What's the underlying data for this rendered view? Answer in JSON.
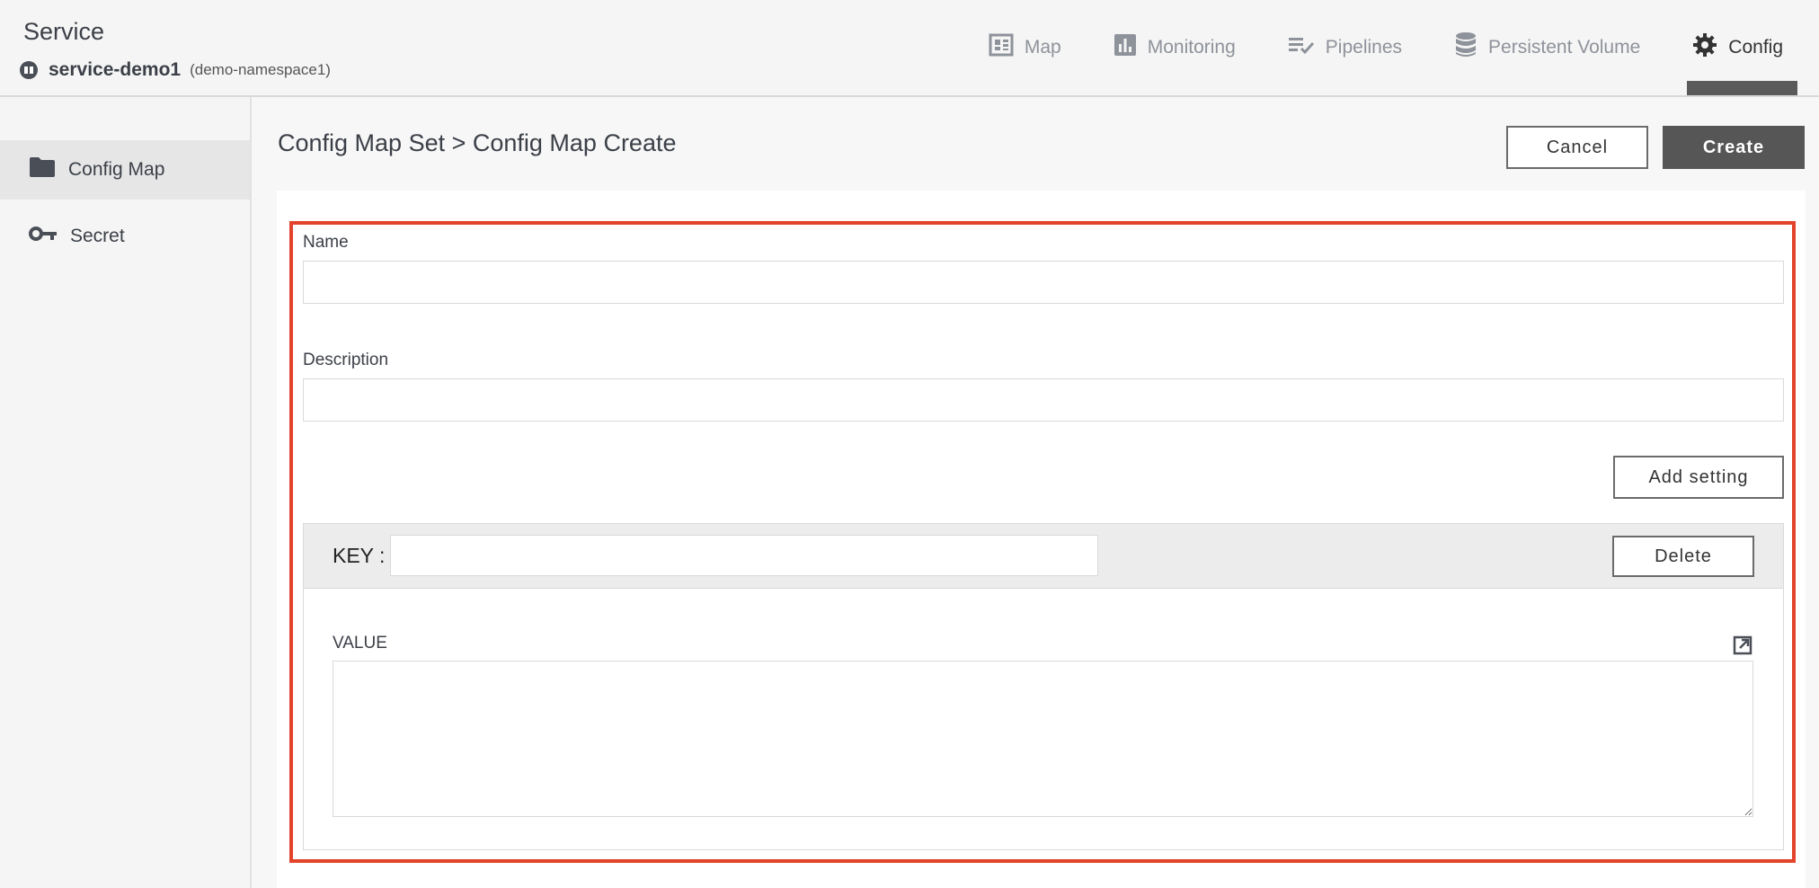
{
  "header": {
    "app_title": "Service",
    "service_name": "service-demo1",
    "namespace": "(demo-namespace1)",
    "tabs": [
      {
        "label": "Map",
        "icon": "dashboard-icon",
        "active": false
      },
      {
        "label": "Monitoring",
        "icon": "bar-chart-icon",
        "active": false
      },
      {
        "label": "Pipelines",
        "icon": "list-check-icon",
        "active": false
      },
      {
        "label": "Persistent Volume",
        "icon": "database-icon",
        "active": false
      },
      {
        "label": "Config",
        "icon": "gear-icon",
        "active": true
      }
    ]
  },
  "sidebar": {
    "items": [
      {
        "label": "Config Map",
        "icon": "folder-icon",
        "active": true
      },
      {
        "label": "Secret",
        "icon": "key-icon",
        "active": false
      }
    ]
  },
  "main": {
    "breadcrumb": "Config Map Set > Config Map Create",
    "cancel_label": "Cancel",
    "create_label": "Create",
    "form": {
      "name_label": "Name",
      "name_value": "",
      "description_label": "Description",
      "description_value": "",
      "add_setting_label": "Add setting",
      "entry": {
        "key_label": "KEY :",
        "key_value": "",
        "delete_label": "Delete",
        "value_label": "VALUE",
        "value_value": ""
      }
    }
  },
  "colors": {
    "highlight_border": "#e2432a",
    "primary_button": "#565656",
    "active_tab_bar": "#5a5a5a"
  }
}
